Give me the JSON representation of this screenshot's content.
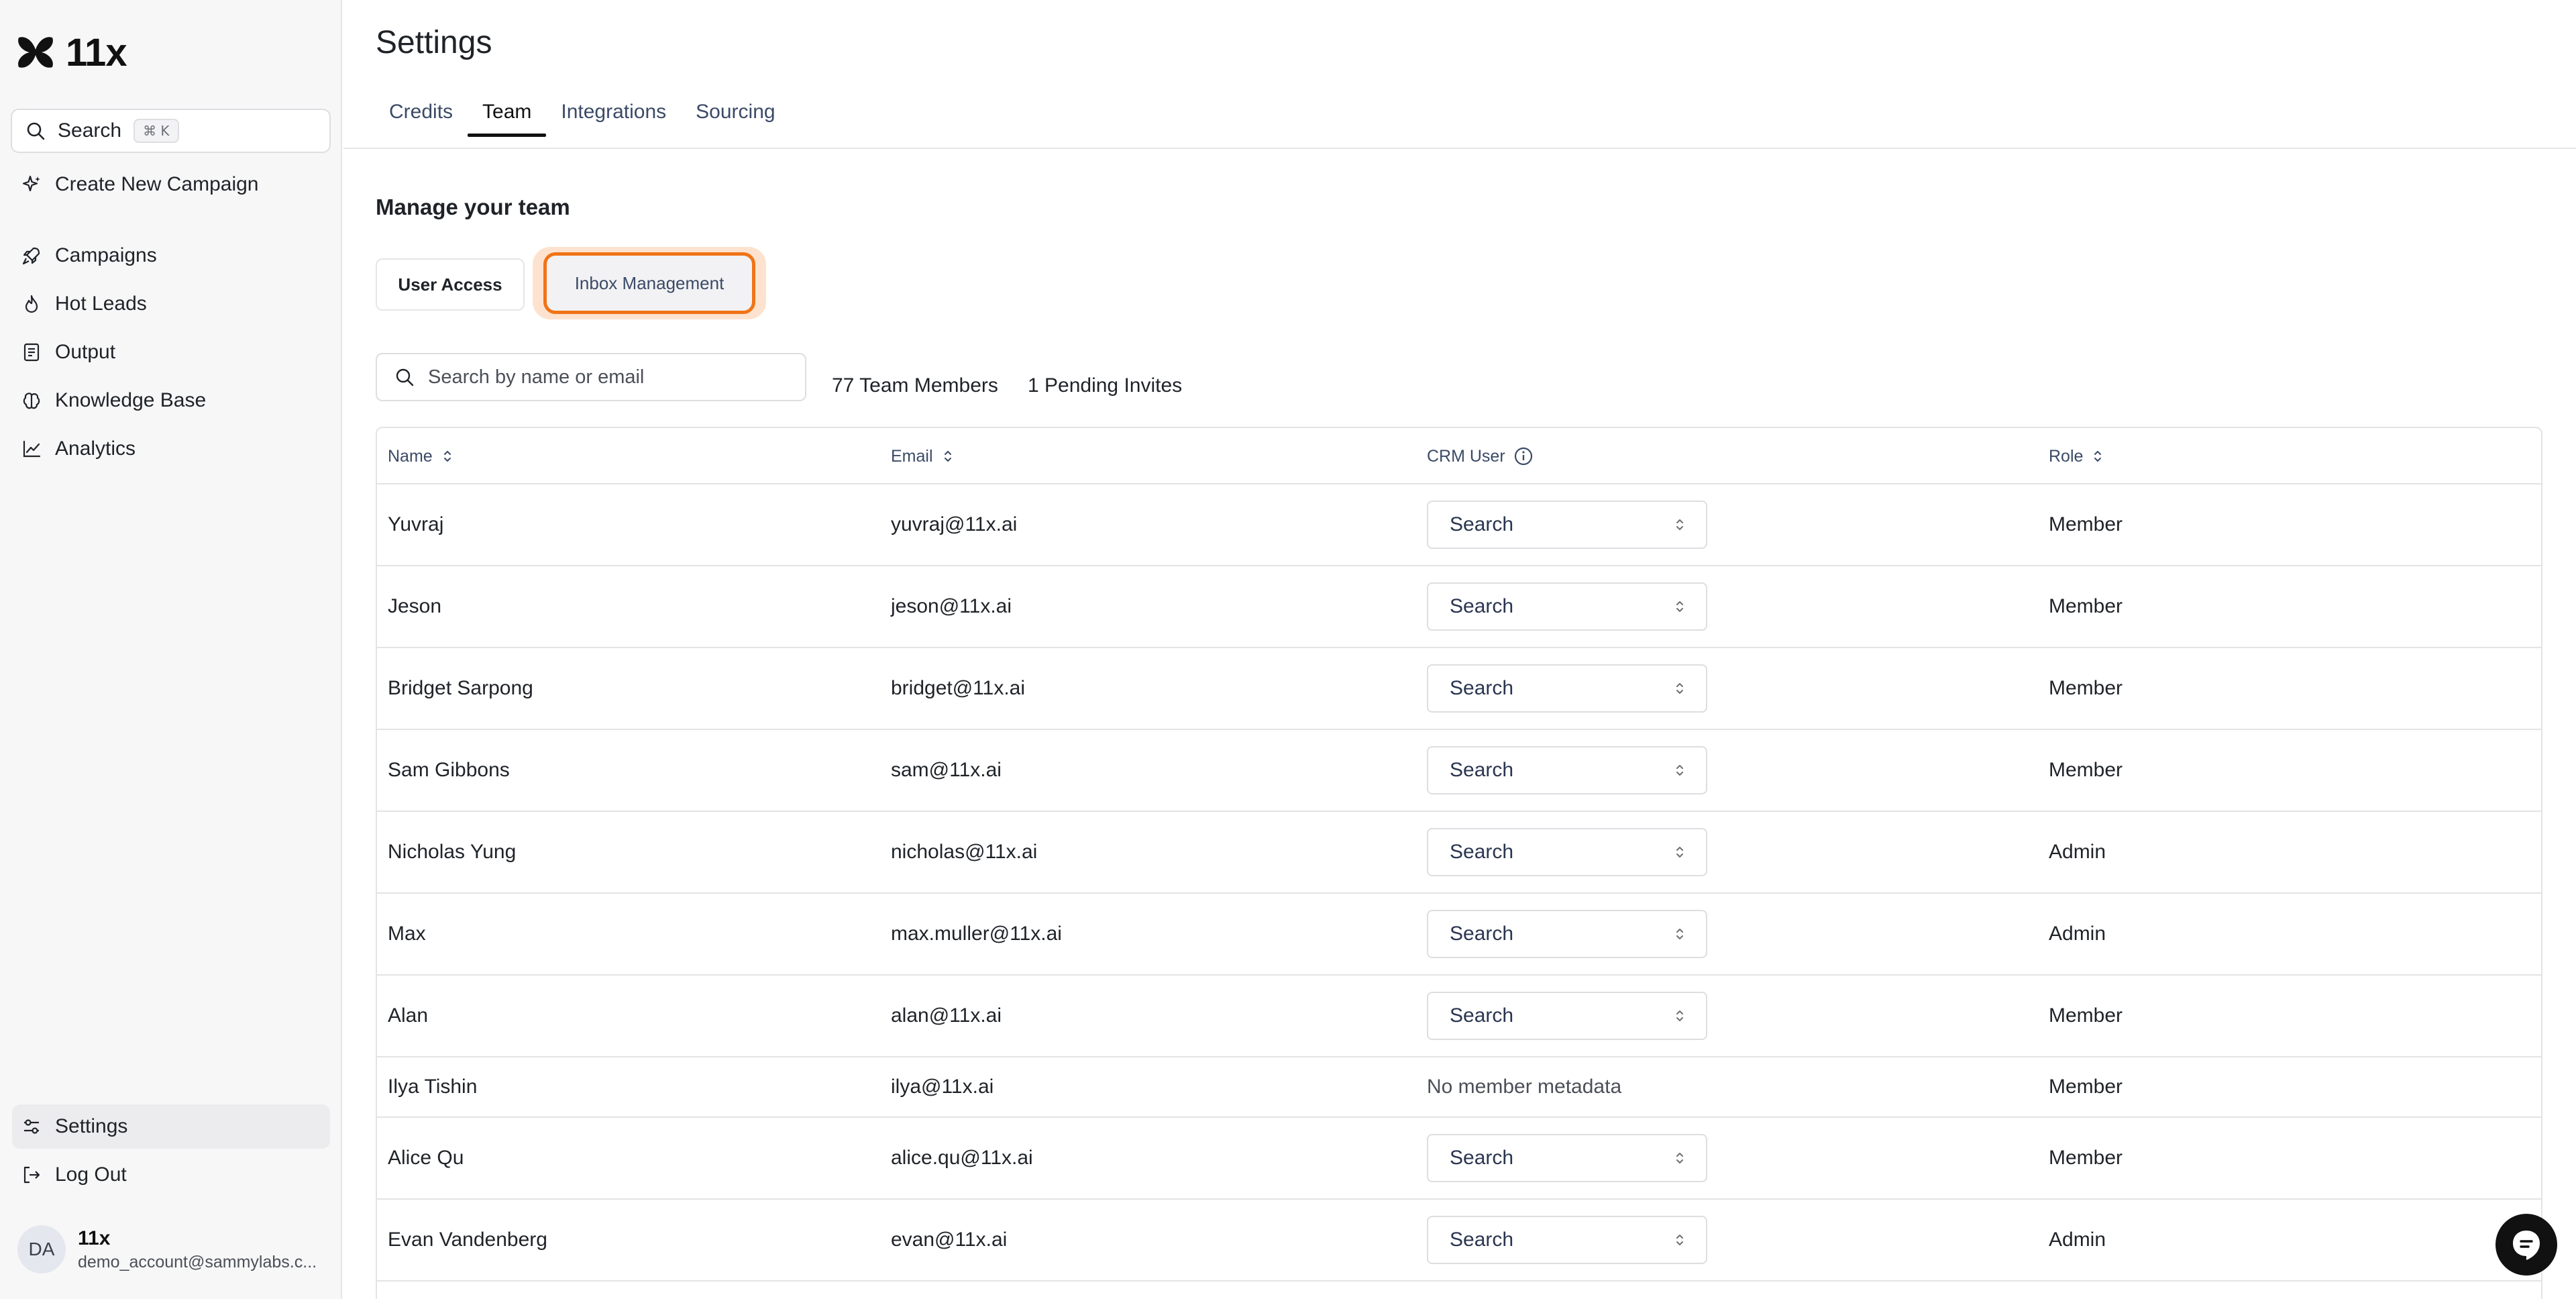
{
  "app": {
    "logo_text": "11x"
  },
  "sidebar": {
    "search_label": "Search",
    "search_shortcut": "⌘ K",
    "create_campaign": "Create New Campaign",
    "nav": [
      {
        "label": "Campaigns",
        "icon": "rocket-icon"
      },
      {
        "label": "Hot Leads",
        "icon": "flame-icon"
      },
      {
        "label": "Output",
        "icon": "document-icon"
      },
      {
        "label": "Knowledge Base",
        "icon": "brain-icon"
      },
      {
        "label": "Analytics",
        "icon": "chart-icon"
      }
    ],
    "settings_label": "Settings",
    "logout_label": "Log Out",
    "account": {
      "initials": "DA",
      "name": "11x",
      "email": "demo_account@sammylabs.c..."
    }
  },
  "header": {
    "title": "Settings",
    "tabs": [
      "Credits",
      "Team",
      "Integrations",
      "Sourcing"
    ],
    "active_tab": "Team"
  },
  "team": {
    "section_title": "Manage your team",
    "segments": {
      "user_access": "User Access",
      "inbox_management": "Inbox Management"
    },
    "search_placeholder": "Search by name or email",
    "members_count": "77 Team Members",
    "pending_invites": "1 Pending Invites",
    "columns": {
      "name": "Name",
      "email": "Email",
      "crm_user": "CRM User",
      "role": "Role"
    },
    "rows": [
      {
        "name": "Yuvraj",
        "email": "yuvraj@11x.ai",
        "crm": "Search",
        "role": "Member"
      },
      {
        "name": "Jeson",
        "email": "jeson@11x.ai",
        "crm": "Search",
        "role": "Member"
      },
      {
        "name": "Bridget Sarpong",
        "email": "bridget@11x.ai",
        "crm": "Search",
        "role": "Member"
      },
      {
        "name": "Sam Gibbons",
        "email": "sam@11x.ai",
        "crm": "Search",
        "role": "Member"
      },
      {
        "name": "Nicholas Yung",
        "email": "nicholas@11x.ai",
        "crm": "Search",
        "role": "Admin"
      },
      {
        "name": "Max",
        "email": "max.muller@11x.ai",
        "crm": "Search",
        "role": "Admin"
      },
      {
        "name": "Alan",
        "email": "alan@11x.ai",
        "crm": "Search",
        "role": "Member"
      },
      {
        "name": "Ilya Tishin",
        "email": "ilya@11x.ai",
        "crm": "No member metadata",
        "role": "Member"
      },
      {
        "name": "Alice Qu",
        "email": "alice.qu@11x.ai",
        "crm": "Search",
        "role": "Member"
      },
      {
        "name": "Evan Vandenberg",
        "email": "evan@11x.ai",
        "crm": "Search",
        "role": "Admin"
      }
    ]
  },
  "colors": {
    "accent": "#f07417",
    "accent_glow": "#fde3cf",
    "sidebar_bg": "#f7f7f8"
  }
}
